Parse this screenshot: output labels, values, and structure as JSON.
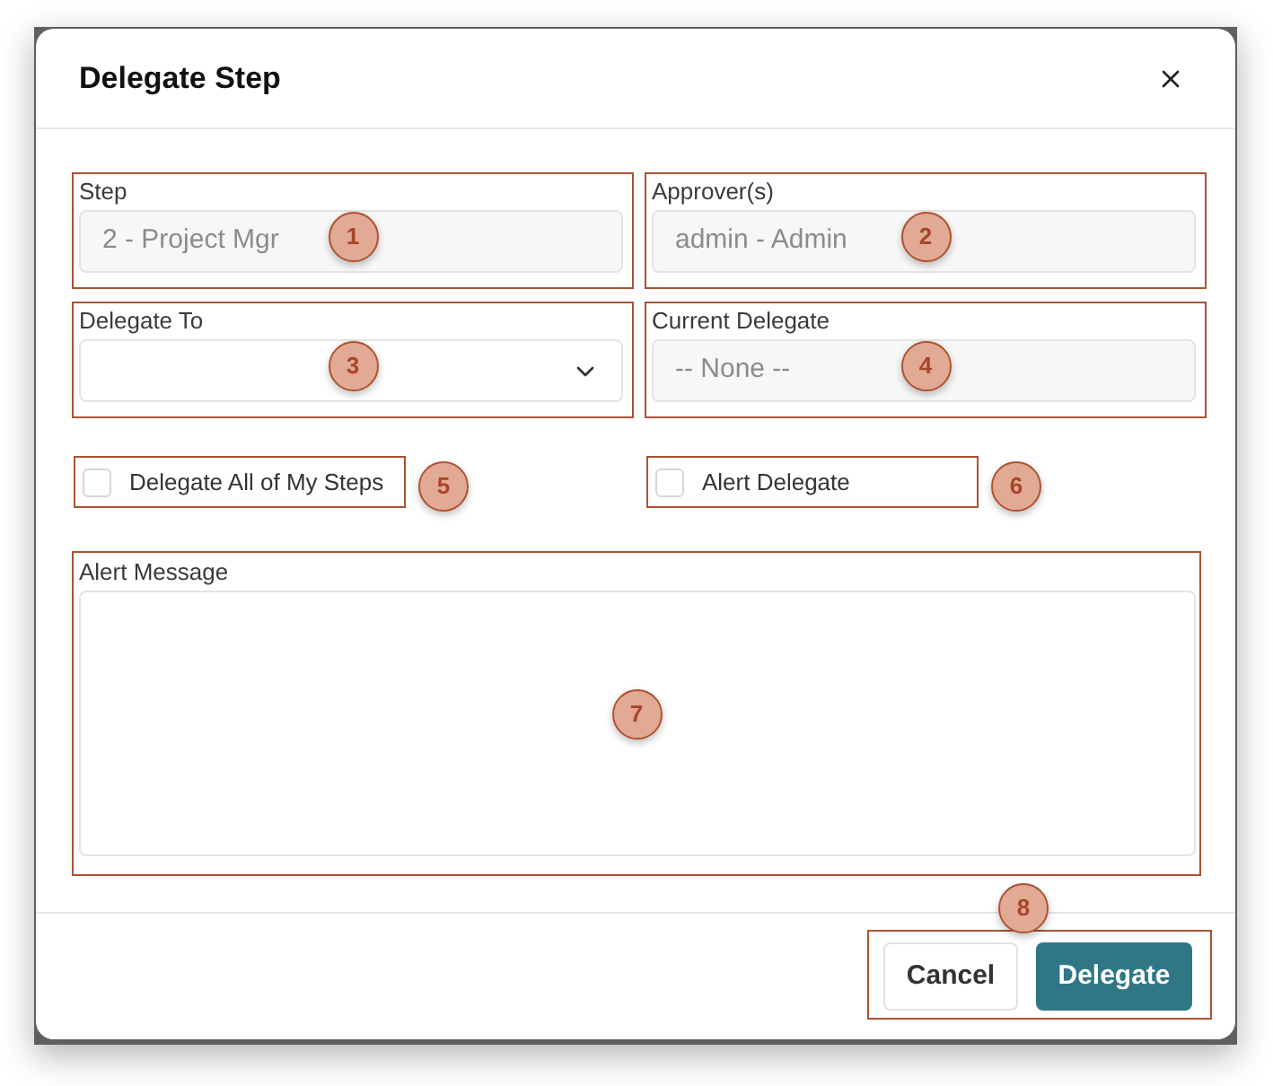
{
  "dialog": {
    "title": "Delegate Step"
  },
  "fields": [
    {
      "kind": "readonly",
      "label": "Step",
      "value": "2 - Project Mgr",
      "callout": "1"
    },
    {
      "kind": "readonly",
      "label": "Approver(s)",
      "value": "admin - Admin",
      "callout": "2"
    },
    {
      "kind": "select",
      "label": "Delegate To",
      "callout": "3"
    },
    {
      "kind": "readonly",
      "label": "Current Delegate",
      "value": "-- None --",
      "callout": "4"
    }
  ],
  "checkboxes": [
    {
      "label": "Delegate All of My Steps",
      "checked": false,
      "callout": "5"
    },
    {
      "label": "Alert Delegate",
      "checked": false,
      "callout": "6"
    }
  ],
  "message": {
    "label": "Alert Message",
    "callout": "7"
  },
  "footer": {
    "callout": "8",
    "buttons": [
      {
        "kind": "secondary",
        "label": "Cancel"
      },
      {
        "kind": "primary",
        "label": "Delegate"
      }
    ]
  }
}
